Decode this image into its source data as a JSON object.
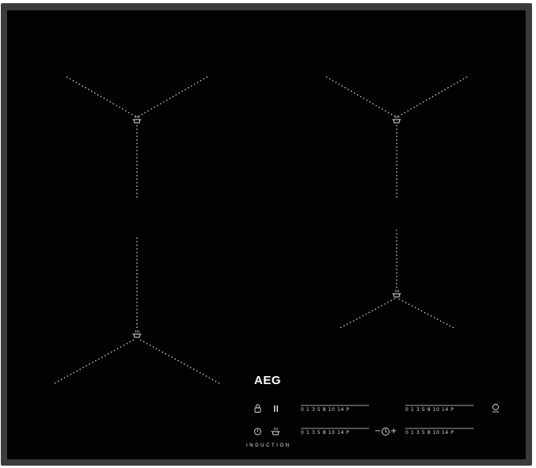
{
  "brand": {
    "logo": "AEG",
    "sub": "INDUCTION"
  },
  "zones": [
    {
      "name": "front-left-zone-marker",
      "icon": "pot-icon"
    },
    {
      "name": "rear-left-zone-marker",
      "icon": "pot-icon"
    },
    {
      "name": "rear-right-zone-marker",
      "icon": "pot-icon"
    },
    {
      "name": "front-right-zone-marker",
      "icon": "pot-icon"
    }
  ],
  "controls": {
    "lock_icon": "lock-icon",
    "pause_icon": "pause-icon",
    "power_icon": "power-icon",
    "hob2hood_icon": "pot-icon",
    "bridge_icon": "bridge-icon",
    "timer_minus": "−",
    "timer_plus": "+",
    "timer_icon": "timer-icon"
  },
  "sliders": [
    {
      "id": "rear-left",
      "scale": "0 1 3 5   8 10   14 P"
    },
    {
      "id": "rear-right",
      "scale": "0 1 3 5   8 10   14 P"
    },
    {
      "id": "front-left",
      "scale": "0 1 3 5   8 10   14 P"
    },
    {
      "id": "front-right",
      "scale": "0 1 3 5   8 10   14 P"
    }
  ],
  "colors": {
    "glass": "#020202",
    "frame": "#3a3b3d",
    "markings": "#e6e6e6"
  }
}
